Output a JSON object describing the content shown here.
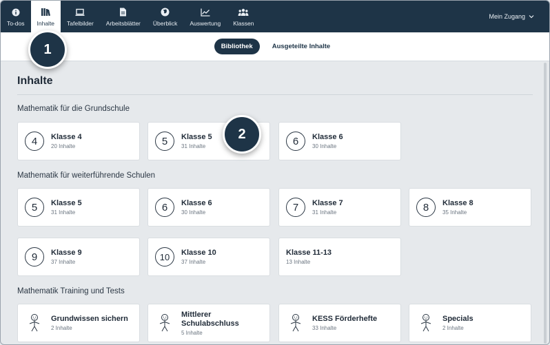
{
  "nav": {
    "items": [
      {
        "label": "To-dos",
        "icon": "info-icon"
      },
      {
        "label": "Inhalte",
        "icon": "library-icon"
      },
      {
        "label": "Tafelbilder",
        "icon": "laptop-icon"
      },
      {
        "label": "Arbeitsblätter",
        "icon": "document-icon"
      },
      {
        "label": "Überblick",
        "icon": "globe-icon"
      },
      {
        "label": "Auswertung",
        "icon": "chart-icon"
      },
      {
        "label": "Klassen",
        "icon": "group-icon"
      }
    ],
    "active_index": 1,
    "account_label": "Mein Zugang",
    "account_icon": "chevron-down-icon"
  },
  "subnav": {
    "library_label": "Bibliothek",
    "distributed_label": "Ausgeteilte Inhalte"
  },
  "callouts": [
    "1",
    "2"
  ],
  "page_title": "Inhalte",
  "sections": [
    {
      "title": "Mathematik für die Grundschule",
      "cards": [
        {
          "badge": "4",
          "title": "Klasse 4",
          "sub": "20 Inhalte"
        },
        {
          "badge": "5",
          "title": "Klasse 5",
          "sub": "31 Inhalte"
        },
        {
          "badge": "6",
          "title": "Klasse 6",
          "sub": "30 Inhalte"
        }
      ]
    },
    {
      "title": "Mathematik für weiterführende Schulen",
      "cards": [
        {
          "badge": "5",
          "title": "Klasse 5",
          "sub": "31 Inhalte"
        },
        {
          "badge": "6",
          "title": "Klasse 6",
          "sub": "30 Inhalte"
        },
        {
          "badge": "7",
          "title": "Klasse 7",
          "sub": "31 Inhalte"
        },
        {
          "badge": "8",
          "title": "Klasse 8",
          "sub": "35 Inhalte"
        },
        {
          "badge": "9",
          "title": "Klasse 9",
          "sub": "37 Inhalte"
        },
        {
          "badge": "10",
          "title": "Klasse 10",
          "sub": "37 Inhalte"
        },
        {
          "badge": "",
          "title": "Klasse 11-13",
          "sub": "13 Inhalte"
        }
      ]
    },
    {
      "title": "Mathematik Training und Tests",
      "cards": [
        {
          "title": "Grundwissen sichern",
          "sub": "2 Inhalte",
          "icon": "stick-figure-icon"
        },
        {
          "title": "Mittlerer Schulabschluss",
          "sub": "5 Inhalte",
          "icon": "stick-figure-icon"
        },
        {
          "title": "KESS Förderhefte",
          "sub": "33 Inhalte",
          "icon": "stick-figure-icon"
        },
        {
          "title": "Specials",
          "sub": "2 Inhalte",
          "icon": "stick-figure-icon"
        }
      ]
    }
  ],
  "colors": {
    "nav_bg": "#1e3447",
    "page_bg": "#e6e9ec",
    "card_bg": "#ffffff"
  }
}
